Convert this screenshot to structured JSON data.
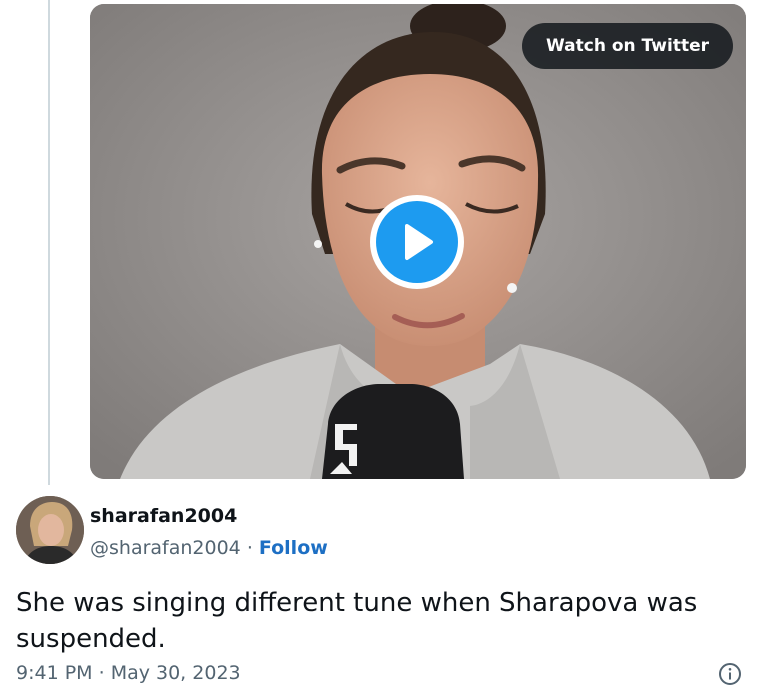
{
  "media": {
    "watch_label": "Watch on Twitter",
    "play_icon": "play-icon",
    "accent_color": "#1d9bf0"
  },
  "author": {
    "name": "sharafan2004",
    "handle": "@sharafan2004",
    "separator": " · ",
    "follow_label": "Follow"
  },
  "tweet": {
    "text": "She was singing different tune when Sharapova was suspended.",
    "time": "9:41 PM",
    "separator": " · ",
    "date": "May 30, 2023",
    "info_icon": "info-icon"
  }
}
